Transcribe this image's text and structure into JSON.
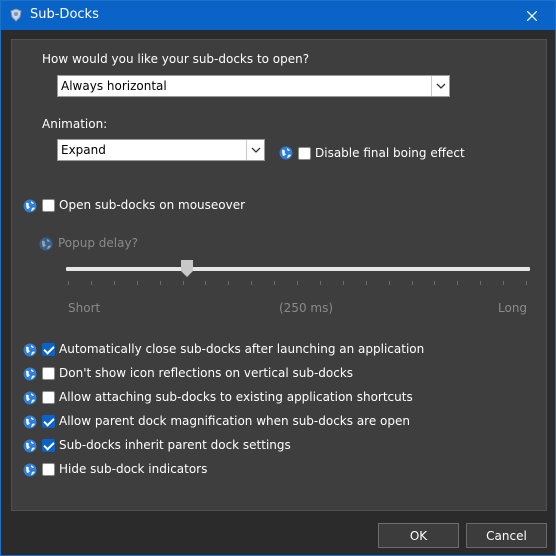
{
  "window": {
    "title": "Sub-Docks"
  },
  "open_section": {
    "question": "How would you like your sub-docks to open?",
    "selected": "Always horizontal"
  },
  "animation_section": {
    "label": "Animation:",
    "selected": "Expand",
    "disable_boing_label": "Disable final boing effect",
    "disable_boing_checked": false
  },
  "mouseover": {
    "label": "Open sub-docks on mouseover",
    "checked": false
  },
  "popup_delay": {
    "label": "Popup delay?",
    "min_label": "Short",
    "value_label": "(250 ms)",
    "max_label": "Long",
    "value_fraction": 0.26
  },
  "options": [
    {
      "label": "Automatically close sub-docks after launching an application",
      "checked": true
    },
    {
      "label": "Don't show icon reflections on vertical sub-docks",
      "checked": false
    },
    {
      "label": "Allow attaching sub-docks to existing application shortcuts",
      "checked": false
    },
    {
      "label": "Allow parent dock magnification when sub-docks are open",
      "checked": true
    },
    {
      "label": "Sub-docks inherit parent dock settings",
      "checked": true
    },
    {
      "label": "Hide sub-dock indicators",
      "checked": false
    }
  ],
  "buttons": {
    "ok": "OK",
    "cancel": "Cancel"
  },
  "colors": {
    "titlebar": "#0a64c8",
    "panel": "#3e3e3e",
    "accent": "#0a64c8"
  }
}
